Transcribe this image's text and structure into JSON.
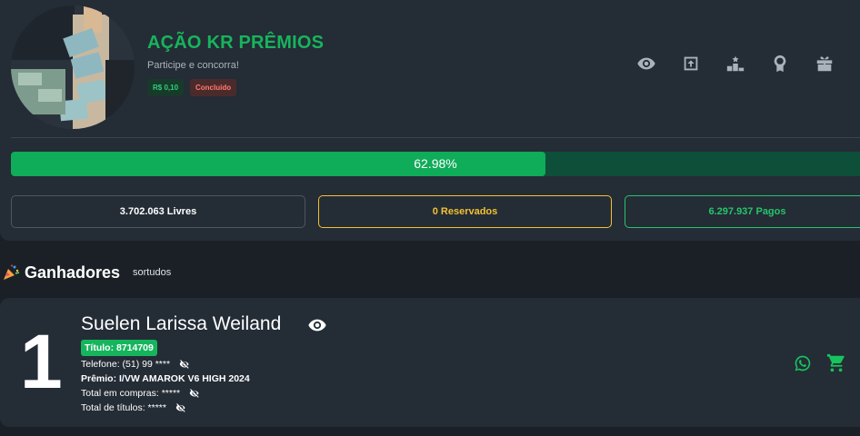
{
  "raffle": {
    "title": "AÇÃO KR PRÊMIOS",
    "subtitle": "Participe e concorra!",
    "price_badge": "R$ 0,10",
    "status_badge": "Concluído"
  },
  "actions": [
    {
      "icon": "eye-icon"
    },
    {
      "icon": "share-icon"
    },
    {
      "icon": "ranking-podium-icon"
    },
    {
      "icon": "award-medal-icon"
    },
    {
      "icon": "gift-icon"
    },
    {
      "icon": "basketball-icon"
    }
  ],
  "progress": {
    "value": 0.6298,
    "label": "62.98%"
  },
  "counts": {
    "free": "3.702.063 Livres",
    "reserved": "0 Reservados",
    "paid": "6.297.937 Pagos"
  },
  "winners": {
    "title": "Ganhadores",
    "subtitle": "sortudos",
    "items": [
      {
        "rank": "1",
        "name": "Suelen Larissa Weiland",
        "ticket": "Título: 8714709",
        "phone": "Telefone: (51) 99 ****",
        "prize": "Prêmio: I/VW AMAROK V6 HIGH 2024",
        "total_purchases": "Total em compras: *****",
        "total_tickets": "Total de títulos: *****"
      }
    ]
  },
  "colors": {
    "accent": "#17b45c",
    "reserved": "#f1c232",
    "paid": "#26c46a",
    "card": "#242c36",
    "background": "#1b2026"
  }
}
